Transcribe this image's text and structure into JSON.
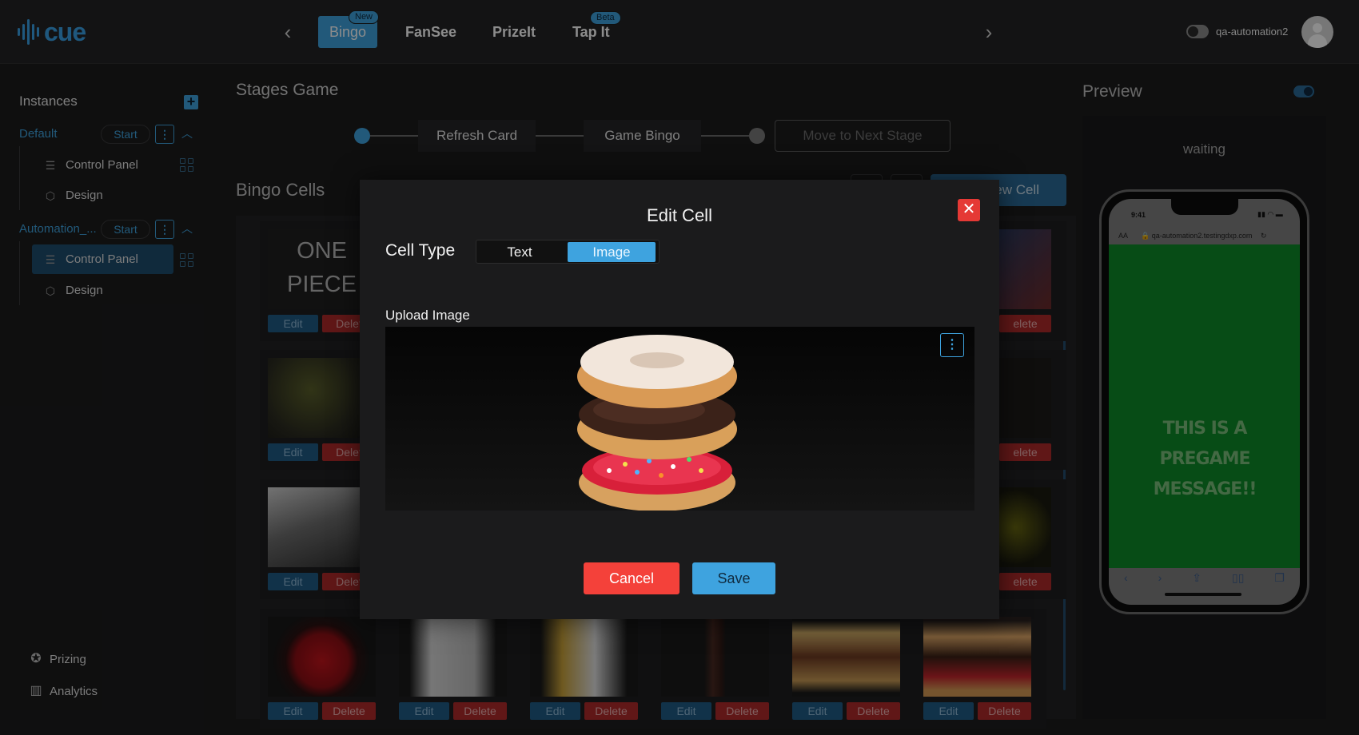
{
  "app": {
    "logo_text": "cue",
    "accent_color": "#3ea3df"
  },
  "header": {
    "tabs": [
      {
        "label": "Bingo",
        "badge": "New",
        "active": true
      },
      {
        "label": "FanSee"
      },
      {
        "label": "PrizeIt"
      },
      {
        "label": "Tap It",
        "badge": "Beta"
      }
    ],
    "prev_icon": "chevron-left-icon",
    "next_icon": "chevron-right-icon",
    "username": "qa-automation2"
  },
  "sidebar": {
    "title": "Instances",
    "add_icon": "plus-icon",
    "instances": [
      {
        "name": "Default",
        "start_label": "Start",
        "items": [
          {
            "label": "Control Panel",
            "active": false
          },
          {
            "label": "Design"
          }
        ]
      },
      {
        "name": "Automation_...",
        "start_label": "Start",
        "items": [
          {
            "label": "Control Panel",
            "active": true
          },
          {
            "label": "Design"
          }
        ]
      }
    ],
    "bottom": [
      {
        "label": "Prizing",
        "icon": "award-icon"
      },
      {
        "label": "Analytics",
        "icon": "bar-chart-icon"
      }
    ]
  },
  "main": {
    "title": "Stages Game",
    "stages": [
      "Refresh Card",
      "Game Bingo"
    ],
    "next_stage_label": "Move to Next Stage",
    "bingo_title": "Bingo Cells",
    "new_cell_label": "ew Cell",
    "cell_text": {
      "line1": "ONE",
      "line2": "PIECE"
    },
    "edit_label": "Edit",
    "delete_label": "Delete",
    "delete_partial": "Delet",
    "delete_tail": "elete"
  },
  "preview": {
    "title": "Preview",
    "status": "waiting",
    "phone": {
      "time": "9:41",
      "url": "qa-automation2.testingdxp.com",
      "url_prefix": "AA",
      "message_line1": "THIS IS A PREGAME",
      "message_line2": "MESSAGE!!",
      "bg_color": "#0d8a29"
    }
  },
  "modal": {
    "title": "Edit Cell",
    "cell_type_label": "Cell Type",
    "options": [
      "Text",
      "Image"
    ],
    "selected": "Image",
    "upload_label": "Upload Image",
    "uploaded_image": "donut-stack-image",
    "cancel_label": "Cancel",
    "save_label": "Save",
    "close_color": "#e53935",
    "cancel_color": "#f4413a"
  }
}
